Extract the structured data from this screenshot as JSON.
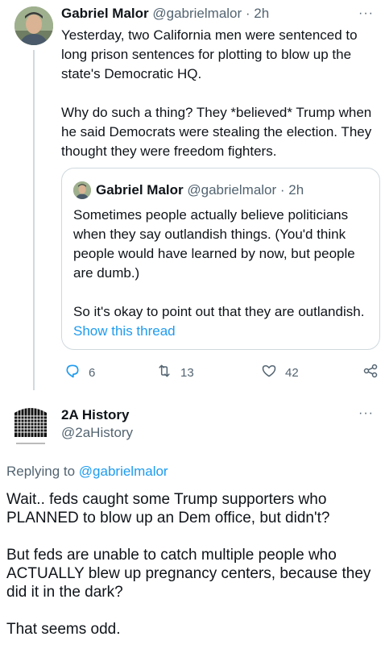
{
  "tweet": {
    "author_name": "Gabriel Malor",
    "author_handle": "@gabrielmalor",
    "time": "· 2h",
    "more": "···",
    "paragraphs": [
      "Yesterday, two California men were sentenced to long prison sentences for plotting to blow up the state's Democratic HQ.",
      "Why do such a thing? They *believed* Trump when he said Democrats were stealing the election. They thought they were freedom fighters."
    ],
    "quote": {
      "author_name": "Gabriel Malor",
      "author_handle": "@gabrielmalor",
      "time": "· 2h",
      "paragraphs": [
        "Sometimes people actually believe politicians when they say outlandish things. (You'd think people would have learned by now, but people are dumb.)",
        "So it's okay to point out that they are outlandish."
      ],
      "show_thread": "Show this thread"
    },
    "actions": {
      "replies": "6",
      "retweets": "13",
      "likes": "42"
    }
  },
  "reply": {
    "author_name": "2A History",
    "author_handle": "@2aHistory",
    "more": "···",
    "replying_prefix": "Replying to",
    "replying_to": "@gabrielmalor",
    "paragraphs": [
      "Wait.. feds caught some Trump supporters who PLANNED to blow up an Dem office, but didn't?",
      "But feds are unable to catch multiple people who ACTUALLY blew up pregnancy centers, because they did it in the dark?",
      "That seems odd."
    ]
  },
  "colors": {
    "link": "#1d9bf0",
    "muted": "#536471",
    "text": "#0f1419",
    "border": "#cfd9de"
  },
  "icons": [
    "reply-icon",
    "retweet-icon",
    "like-icon",
    "share-icon",
    "more-icon"
  ]
}
